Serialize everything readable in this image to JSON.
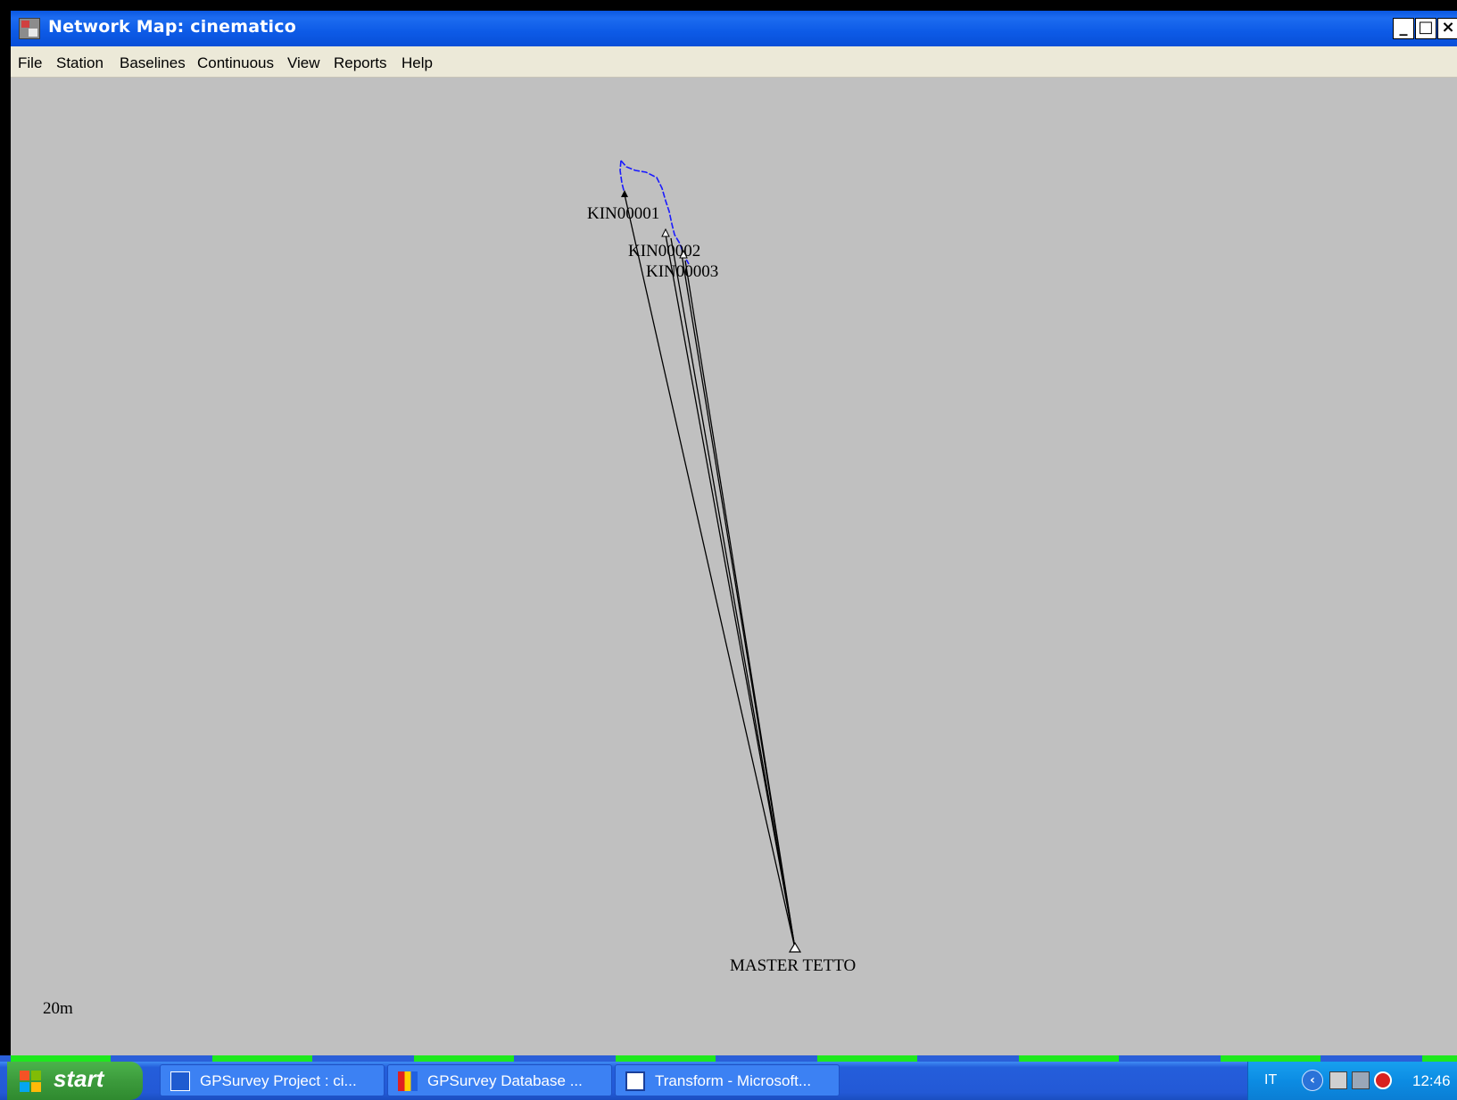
{
  "window": {
    "title": "Network Map: cinematico",
    "buttons": {
      "minimize": "_",
      "maximize": "□",
      "close": "×"
    }
  },
  "menu": {
    "items": [
      "File",
      "Station",
      "Baselines",
      "Continuous",
      "View",
      "Reports",
      "Help"
    ]
  },
  "map": {
    "stations": [
      {
        "name": "KIN00001"
      },
      {
        "name": "KIN00002"
      },
      {
        "name": "KIN00003"
      },
      {
        "name": "MASTER TETTO"
      }
    ],
    "scale_label": "20m",
    "colors": {
      "background": "#c0c0c0",
      "baseline": "#000000",
      "trajectory": "#1a1aff"
    }
  },
  "taskbar": {
    "start_label": "start",
    "tasks": [
      {
        "label": "GPSurvey Project : ci...",
        "icon": "gpsurvey-project-icon"
      },
      {
        "label": "GPSurvey Database ...",
        "icon": "gpsurvey-database-icon"
      },
      {
        "label": "Transform - Microsoft...",
        "icon": "word-document-icon"
      }
    ],
    "tray": {
      "language": "IT",
      "clock": "12:46",
      "icons": [
        "show-hidden-icons-arrow",
        "network-icon",
        "network-error-icon",
        "security-alert-icon"
      ]
    }
  }
}
